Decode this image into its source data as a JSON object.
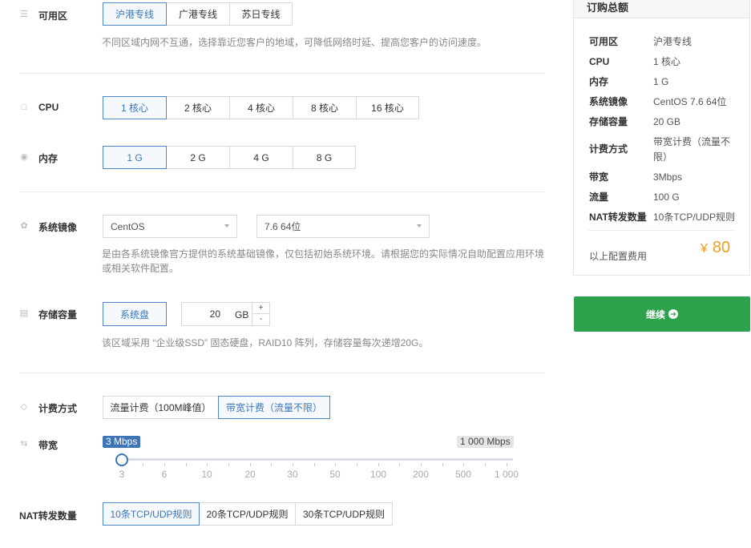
{
  "region": {
    "label": "可用区",
    "options": [
      "沪港专线",
      "广港专线",
      "苏日专线"
    ],
    "selected": 0,
    "desc": "不同区域内网不互通，选择靠近您客户的地域，可降低网络时延、提高您客户的访问速度。"
  },
  "cpu": {
    "label": "CPU",
    "options": [
      "1 核心",
      "2 核心",
      "4 核心",
      "8 核心",
      "16 核心"
    ],
    "selected": 0
  },
  "memory": {
    "label": "内存",
    "options": [
      "1 G",
      "2 G",
      "4 G",
      "8 G"
    ],
    "selected": 0
  },
  "image": {
    "label": "系统镜像",
    "os_value": "CentOS",
    "version_value": "7.6 64位",
    "desc_line1": "是由各系统镜像官方提供的系统基础镜像，仅包括初始系统环境。请根据您的实际情况自助配置应用环境",
    "desc_line2": "或相关软件配置。"
  },
  "storage": {
    "label": "存储容量",
    "disk_button": "系统盘",
    "value": "20",
    "unit": "GB",
    "plus": "+",
    "minus": "-",
    "desc": "该区域采用 “企业级SSD” 固态硬盘，RAID10 阵列，存储容量每次递增20G。"
  },
  "billing": {
    "label": "计费方式",
    "options": [
      "流量计费（100M峰值）",
      "带宽计费（流量不限）"
    ],
    "selected": 1
  },
  "bandwidth": {
    "label": "带宽",
    "current_label": "3 Mbps",
    "max_label": "1 000 Mbps",
    "value_mbps": 3,
    "ticks": [
      "3",
      "6",
      "10",
      "20",
      "30",
      "50",
      "100",
      "200",
      "500",
      "1 000"
    ]
  },
  "nat": {
    "label": "NAT转发数量",
    "options": [
      "10条TCP/UDP规则",
      "20条TCP/UDP规则",
      "30条TCP/UDP规则"
    ],
    "selected": 0
  },
  "summary": {
    "title": "订购总额",
    "rows": [
      {
        "k": "可用区",
        "v": "沪港专线"
      },
      {
        "k": "CPU",
        "v": "1 核心"
      },
      {
        "k": "内存",
        "v": "1 G"
      },
      {
        "k": "系统镜像",
        "v": "CentOS 7.6 64位"
      },
      {
        "k": "存储容量",
        "v": "20 GB"
      },
      {
        "k": "计费方式",
        "v": "带宽计费（流量不限）"
      },
      {
        "k": "带宽",
        "v": "3Mbps"
      },
      {
        "k": "流量",
        "v": "100 G"
      },
      {
        "k": "NAT转发数量",
        "v": "10条TCP/UDP规则"
      }
    ],
    "total_label": "以上配置费用",
    "currency": "¥",
    "total": "80"
  },
  "continue_label": "继续",
  "colors": {
    "accent": "#3f74b7",
    "price": "#f39c1f",
    "continue": "#2da24c"
  }
}
